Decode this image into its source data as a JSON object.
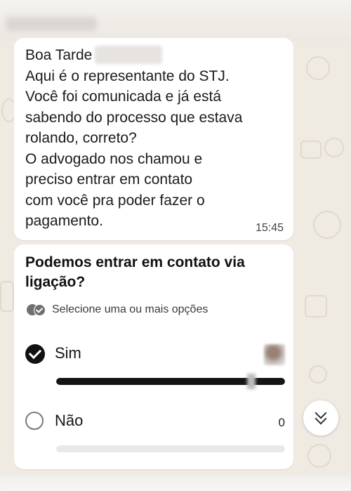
{
  "header": {
    "contact_name_blurred": "Boa Tarde"
  },
  "message": {
    "greeting": "Boa Tarde",
    "lines": [
      "Aqui é o representante do STJ.",
      "Você foi comunicada e já está",
      "sabendo do processo que estava",
      "rolando, correto?",
      "O advogado nos chamou e",
      "preciso entrar em contato",
      "com você pra poder fazer o",
      "pagamento."
    ],
    "time": "15:45"
  },
  "poll": {
    "question": "Podemos entrar em contato via ligação?",
    "hint": "Selecione uma ou mais opções",
    "options": [
      {
        "label": "Sim",
        "selected": true,
        "fraction": 1.0
      },
      {
        "label": "Não",
        "selected": false,
        "count": "0",
        "fraction": 0.0
      }
    ]
  },
  "colors": {
    "wallpaper": "#efeae2",
    "bubble": "#ffffff",
    "poll_fill": "#151515",
    "poll_track": "#e9e9e9"
  },
  "icons": {
    "selected_option": "check-filled-icon",
    "unselected_option": "radio-empty-icon",
    "multi_select_hint": "double-check-icon",
    "scroll_down": "chevrons-down-icon"
  }
}
